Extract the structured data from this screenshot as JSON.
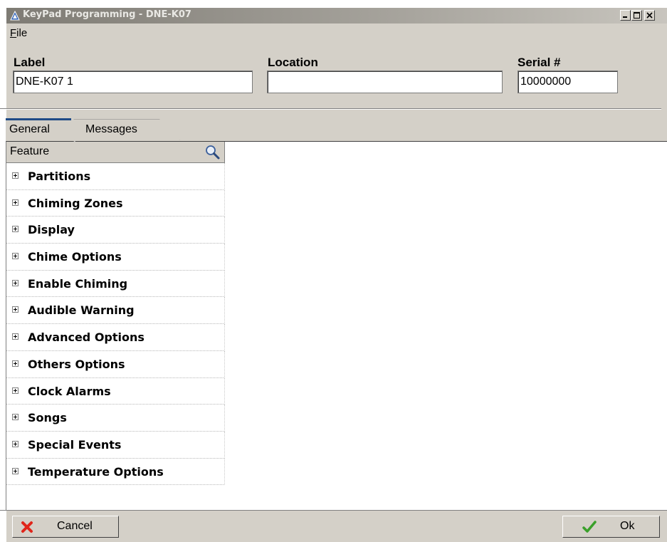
{
  "window": {
    "title": "KeyPad Programming - DNE-K07",
    "title_icon": "app-triangle-icon",
    "controls": [
      "minimize-icon",
      "maximize-icon",
      "close-icon"
    ]
  },
  "menu": {
    "file": {
      "accel": "F",
      "rest": "ile"
    }
  },
  "fields": {
    "label": {
      "caption": "Label",
      "value": "DNE-K07 1"
    },
    "location": {
      "caption": "Location",
      "value": ""
    },
    "serial": {
      "caption": "Serial #",
      "value": "10000000"
    }
  },
  "tabs": [
    {
      "label": "General",
      "active": true
    },
    {
      "label": "Messages",
      "active": false
    }
  ],
  "feature_header": {
    "label": "Feature",
    "icon": "search-icon"
  },
  "features": [
    "Partitions",
    "Chiming Zones",
    "Display",
    "Chime Options",
    "Enable Chiming",
    "Audible Warning",
    "Advanced Options",
    "Others Options",
    "Clock Alarms",
    "Songs",
    "Special Events",
    "Temperature Options"
  ],
  "buttons": {
    "cancel": {
      "label": "Cancel",
      "icon": "red-x-icon"
    },
    "ok": {
      "label": "Ok",
      "icon": "green-check-icon"
    }
  },
  "colors": {
    "window_bg": "#d4d0c8",
    "active_tab_accent": "#1f4a86",
    "cancel_icon": "#e0261b",
    "ok_icon": "#3aa02a"
  }
}
